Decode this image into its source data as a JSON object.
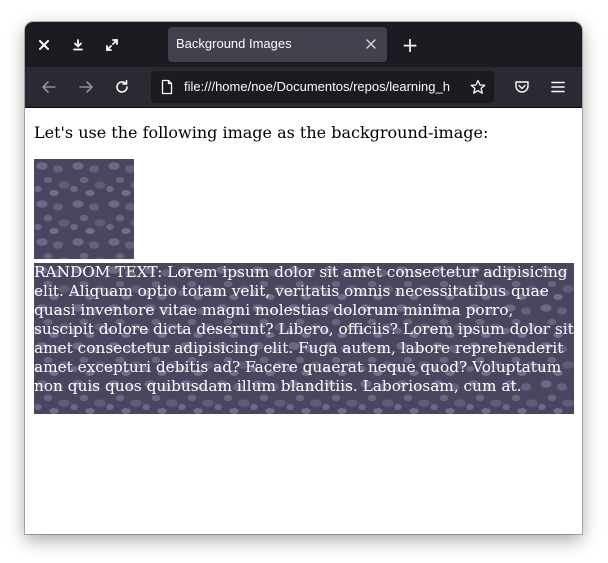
{
  "window": {
    "tab_title": "Background Images",
    "new_tab_symbol": "+",
    "url": "file:///home/noe/Documentos/repos/learning_h"
  },
  "toolbar_icons": [
    "close-icon",
    "download-icon",
    "maximize-icon",
    "back-icon",
    "forward-icon",
    "reload-icon",
    "page-icon",
    "bookmark-star-icon",
    "pocket-icon",
    "menu-icon"
  ],
  "page": {
    "intro": "Let's use the following image as the background-image:",
    "body_text": "RANDOM TEXT: Lorem ipsum dolor sit amet consectetur adipisicing elit. Aliquam optio totam velit, veritatis omnis necessitatibus quae quasi inventore vitae magni molestias dolorum minima porro, suscipit dolore dicta deserunt? Libero, officiis? Lorem ipsum dolor sit amet consectetur adipisicing elit. Fuga autem, labore reprehenderit amet excepturi debitis ad? Facere quaerat neque quod? Voluptatum non quis quos quibusdam illum blanditiis. Laboriosam, cum at."
  },
  "colors": {
    "titlebar": "#1c1b22",
    "toolbar": "#2b2a33",
    "active_tab": "#42414d",
    "stone_base": "#4b4560",
    "stone_highlight": "#6b6a86"
  }
}
